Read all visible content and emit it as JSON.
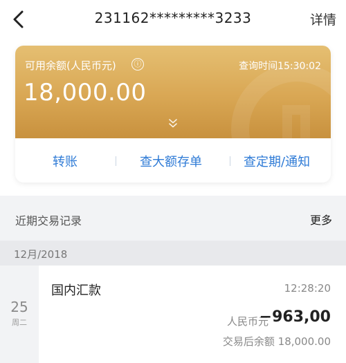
{
  "header": {
    "account_masked": "231162*********3233",
    "detail_label": "详情"
  },
  "balance_card": {
    "label": "可用余额(人民币元)",
    "info_icon": "ⓘ",
    "query_time": "查询时间15:30:02",
    "amount": "18,000.00",
    "expand_icon": "double-chevron-down-icon"
  },
  "actions": [
    {
      "label": "转账"
    },
    {
      "label": "查大额存单"
    },
    {
      "label": "查定期/通知"
    }
  ],
  "recent": {
    "title": "近期交易记录",
    "more_label": "更多"
  },
  "transactions": {
    "month": "12月/2018",
    "items": [
      {
        "day": "25",
        "weekday": "周二",
        "name": "国内汇款",
        "time": "12:28:20",
        "currency": "人民币元",
        "amount": "−963,00",
        "balance_after": "交易后余额 18,000.00"
      }
    ]
  },
  "colors": {
    "card_gold": "#d9a754",
    "action_blue": "#2f7bd6"
  }
}
